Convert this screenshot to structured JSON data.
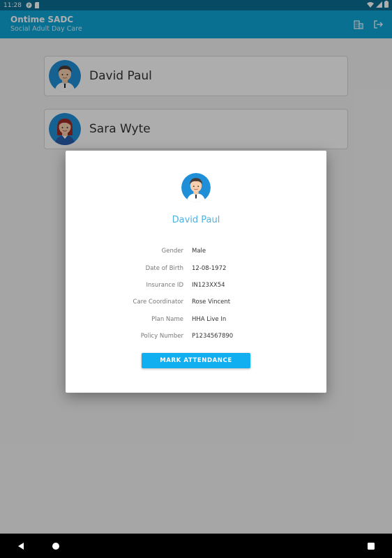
{
  "status_bar": {
    "time": "11:28"
  },
  "app_bar": {
    "title": "Ontime SADC",
    "subtitle": "Social Adult Day Care",
    "actions": [
      "building-icon",
      "logout-icon"
    ]
  },
  "members": [
    {
      "name": "David Paul",
      "avatar": "male-avatar"
    },
    {
      "name": "Sara Wyte",
      "avatar": "female-avatar"
    }
  ],
  "dialog": {
    "name": "David Paul",
    "fields": [
      {
        "label": "Gender",
        "value": "Male"
      },
      {
        "label": "Date of Birth",
        "value": "12-08-1972"
      },
      {
        "label": "Insurance ID",
        "value": "IN123XX54"
      },
      {
        "label": "Care Coordinator",
        "value": "Rose Vincent"
      },
      {
        "label": "Plan Name",
        "value": "HHA Live In"
      },
      {
        "label": "Policy Number",
        "value": "P1234567890"
      }
    ],
    "button_label": "MARK ATTENDANCE"
  },
  "colors": {
    "status_bar": "#0b6e92",
    "app_bar": "#0ea5d8",
    "accent": "#11aef0",
    "dialog_name": "#4db2e4"
  }
}
